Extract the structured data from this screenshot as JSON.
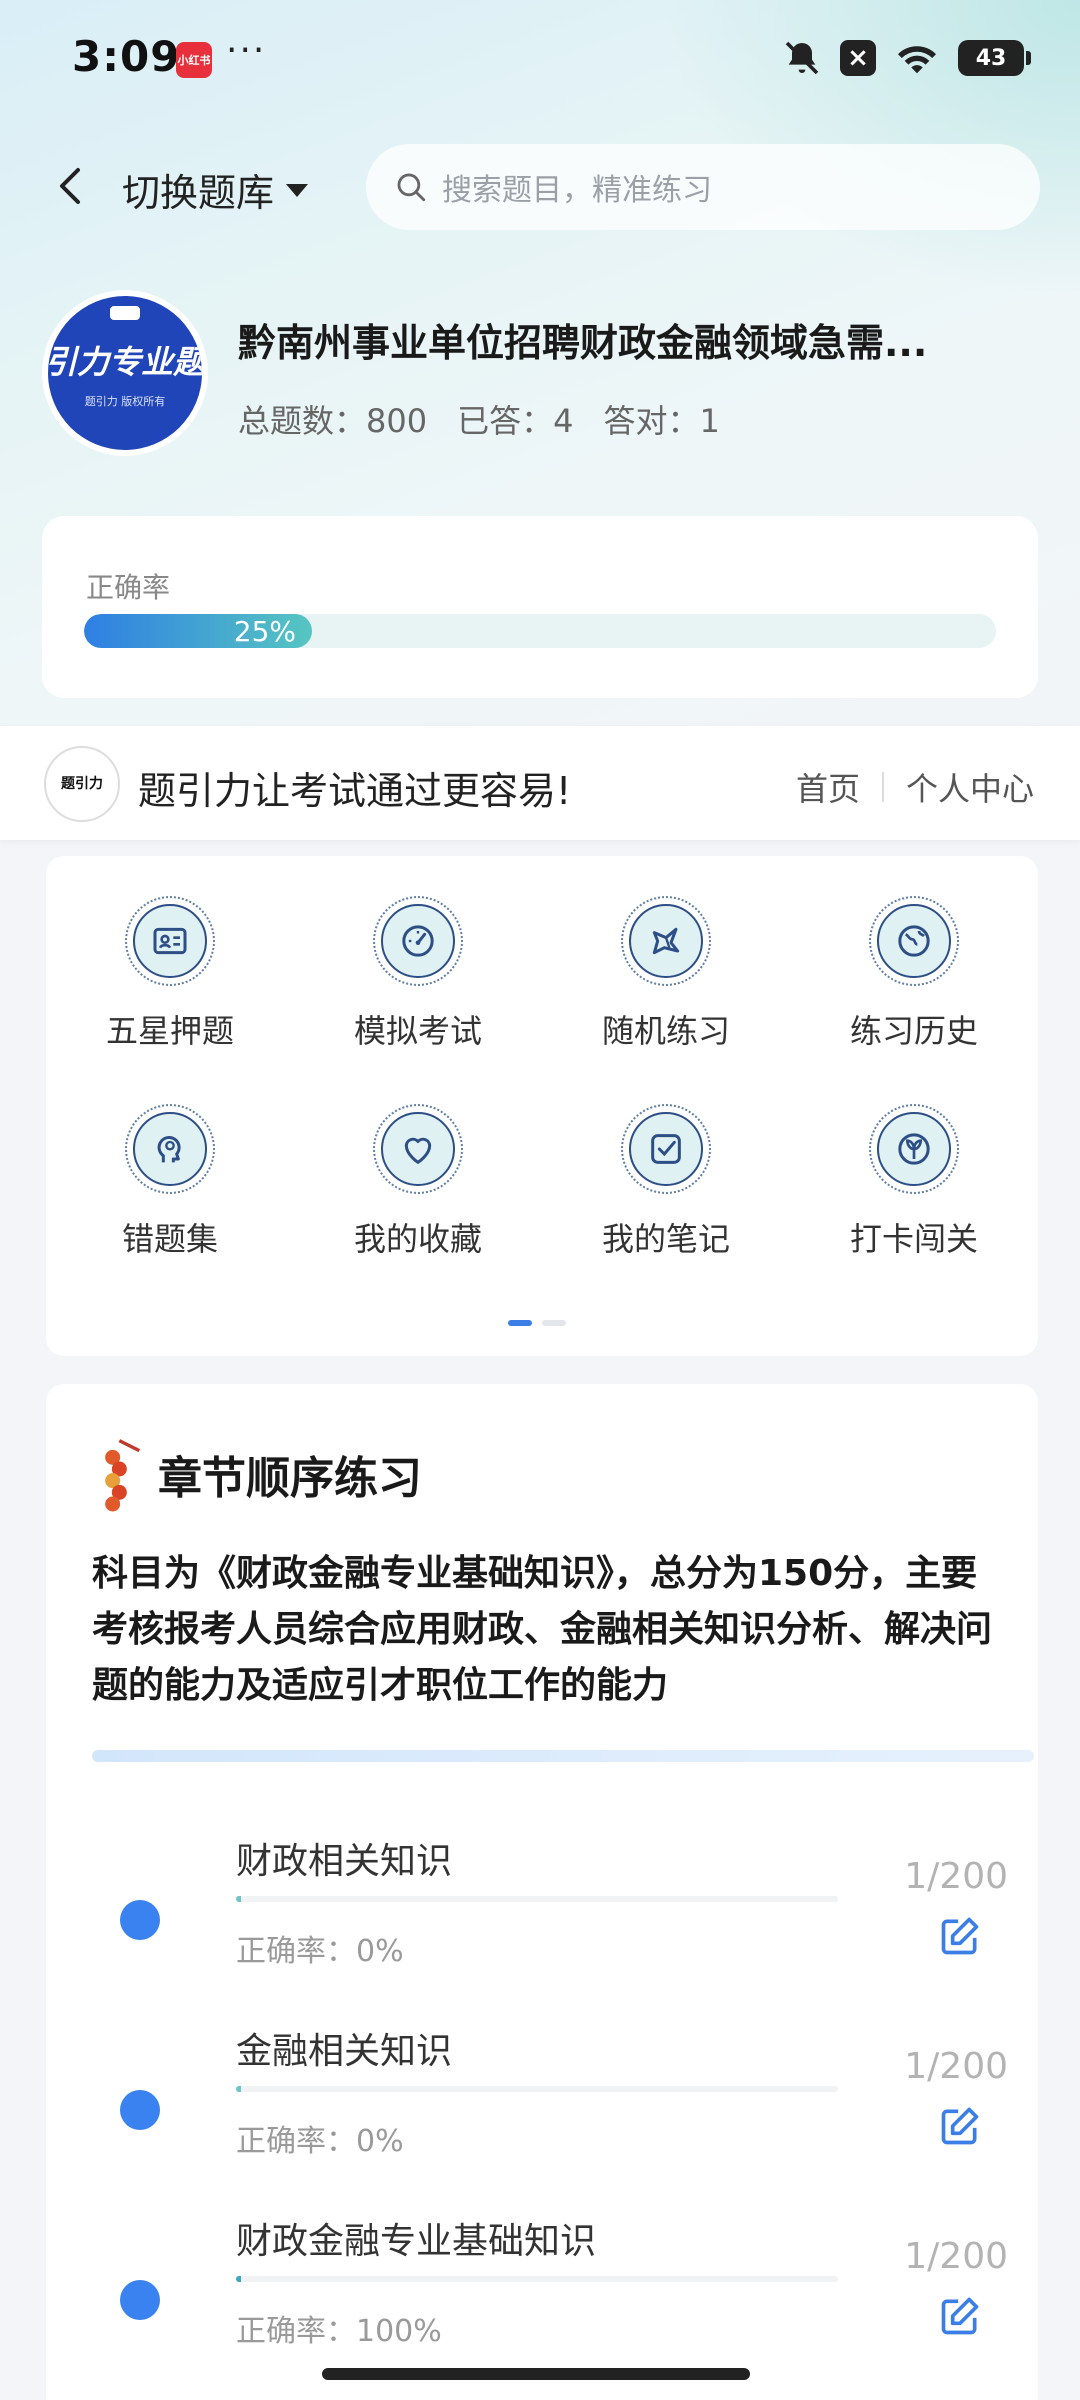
{
  "status_bar": {
    "time": "3:09",
    "app_badge": "小红书",
    "more": "···",
    "battery": "43"
  },
  "header": {
    "switch_label": "切换题库",
    "search_placeholder": "搜索题目，精准练习"
  },
  "bank": {
    "avatar_title": "引力专业题",
    "avatar_sub": "题引力 版权所有",
    "title": "黔南州事业单位招聘财政金融领域急需...",
    "total_label": "总题数：800",
    "answered_label": "已答：4",
    "correct_label": "答对：1",
    "accuracy_label": "正确率",
    "accuracy_text": "25%",
    "accuracy_value": 25
  },
  "banner": {
    "logo": "题引力",
    "slogan": "题引力让考试通过更容易!",
    "home": "首页",
    "personal": "个人中心"
  },
  "grid": {
    "items": [
      {
        "label": "五星押题",
        "icon": "id-card-icon"
      },
      {
        "label": "模拟考试",
        "icon": "gauge-icon"
      },
      {
        "label": "随机练习",
        "icon": "shuffle-icon"
      },
      {
        "label": "练习历史",
        "icon": "globe-icon"
      },
      {
        "label": "错题集",
        "icon": "head-icon"
      },
      {
        "label": "我的收藏",
        "icon": "heart-icon"
      },
      {
        "label": "我的笔记",
        "icon": "note-icon"
      },
      {
        "label": "打卡闯关",
        "icon": "leaf-icon"
      }
    ]
  },
  "chapters": {
    "title": "章节顺序练习",
    "description": "科目为《财政金融专业基础知识》，总分为150分，主要考核报考人员综合应用财政、金融相关知识分析、解决问题的能力及适应引才职位工作的能力",
    "items": [
      {
        "name": "财政相关知识",
        "accuracy": "正确率：0%",
        "count": "1/200",
        "progress": 0.005
      },
      {
        "name": "金融相关知识",
        "accuracy": "正确率：0%",
        "count": "1/200",
        "progress": 0.005
      },
      {
        "name": "财政金融专业基础知识",
        "accuracy": "正确率：100%",
        "count": "1/200",
        "progress": 0.005
      }
    ]
  },
  "colors": {
    "accent": "#3a82ef",
    "progress_start": "#2f7fe3",
    "progress_end": "#56c6c1"
  }
}
